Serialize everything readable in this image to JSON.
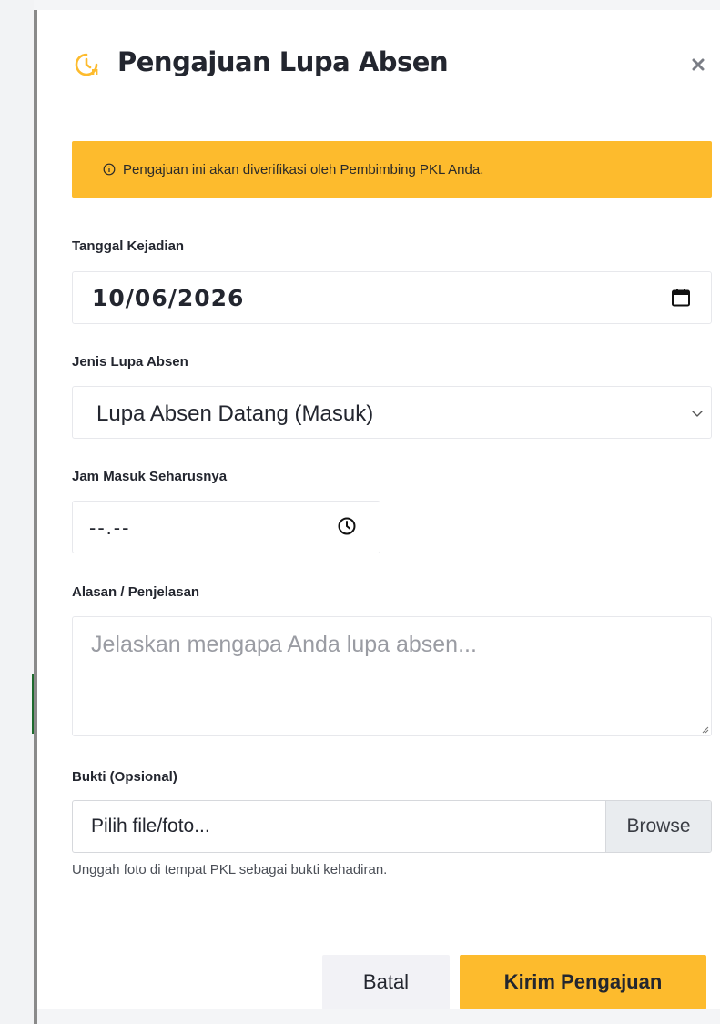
{
  "modal": {
    "title": "Pengajuan Lupa Absen",
    "title_icon": "clock-history-icon",
    "close_icon": "close-icon"
  },
  "alert": {
    "icon": "info-icon",
    "text": "Pengajuan ini akan diverifikasi oleh Pembimbing PKL Anda."
  },
  "form": {
    "date": {
      "label": "Tanggal Kejadian",
      "value": "10/06/2026",
      "icon": "calendar-icon"
    },
    "type": {
      "label": "Jenis Lupa Absen",
      "selected": "Lupa Absen Datang (Masuk)",
      "icon": "chevron-down-icon"
    },
    "time": {
      "label": "Jam Masuk Seharusnya",
      "value": "--.--",
      "icon": "clock-icon"
    },
    "reason": {
      "label": "Alasan / Penjelasan",
      "placeholder": "Jelaskan mengapa Anda lupa absen..."
    },
    "proof": {
      "label": "Bukti (Opsional)",
      "placeholder": "Pilih file/foto...",
      "browse_label": "Browse",
      "help": "Unggah foto di tempat PKL sebagai bukti kehadiran."
    }
  },
  "actions": {
    "cancel_label": "Batal",
    "submit_label": "Kirim Pengajuan"
  },
  "colors": {
    "accent": "#fdbb2d",
    "text": "#23262f",
    "muted": "#9a9ca3"
  }
}
